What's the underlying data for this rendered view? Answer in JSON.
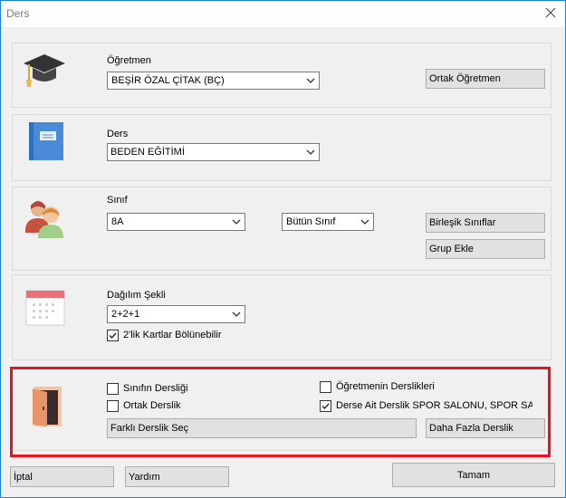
{
  "window": {
    "title": "Ders"
  },
  "teacher": {
    "label": "Öğretmen",
    "value": "BEŞİR ÖZAL ÇİTAK (BÇ)",
    "common_teacher_button": "Ortak Öğretmen"
  },
  "lesson": {
    "label": "Ders",
    "value": "BEDEN EĞİTİMİ"
  },
  "class": {
    "label": "Sınıf",
    "value": "8A",
    "whole_class_value": "Bütün Sınıf",
    "combined_classes_button": "Birleşik Sınıflar",
    "add_group_button": "Grup Ekle"
  },
  "distribution": {
    "label": "Dağılım Şekli",
    "value": "2+2+1",
    "splittable_label": "2'lik Kartlar Bölünebilir",
    "splittable_checked": true
  },
  "classroom": {
    "class_room_label": "Sınıfın Dersliği",
    "class_room_checked": false,
    "shared_room_label": "Ortak Derslik",
    "shared_room_checked": false,
    "teacher_rooms_label": "Öğretmenin Derslikleri",
    "teacher_rooms_checked": false,
    "lesson_rooms_label": "Derse Ait Derslik SPOR SALONU, SPOR SALONU",
    "lesson_rooms_checked": true,
    "select_other_button": "Farklı Derslik Seç",
    "more_rooms_button": "Daha Fazla Derslik"
  },
  "footer": {
    "cancel_button": "İptal",
    "help_button": "Yardım",
    "ok_button": "Tamam"
  },
  "colors": {
    "highlight_border": "#e81123",
    "window_border": "#1883d7"
  }
}
